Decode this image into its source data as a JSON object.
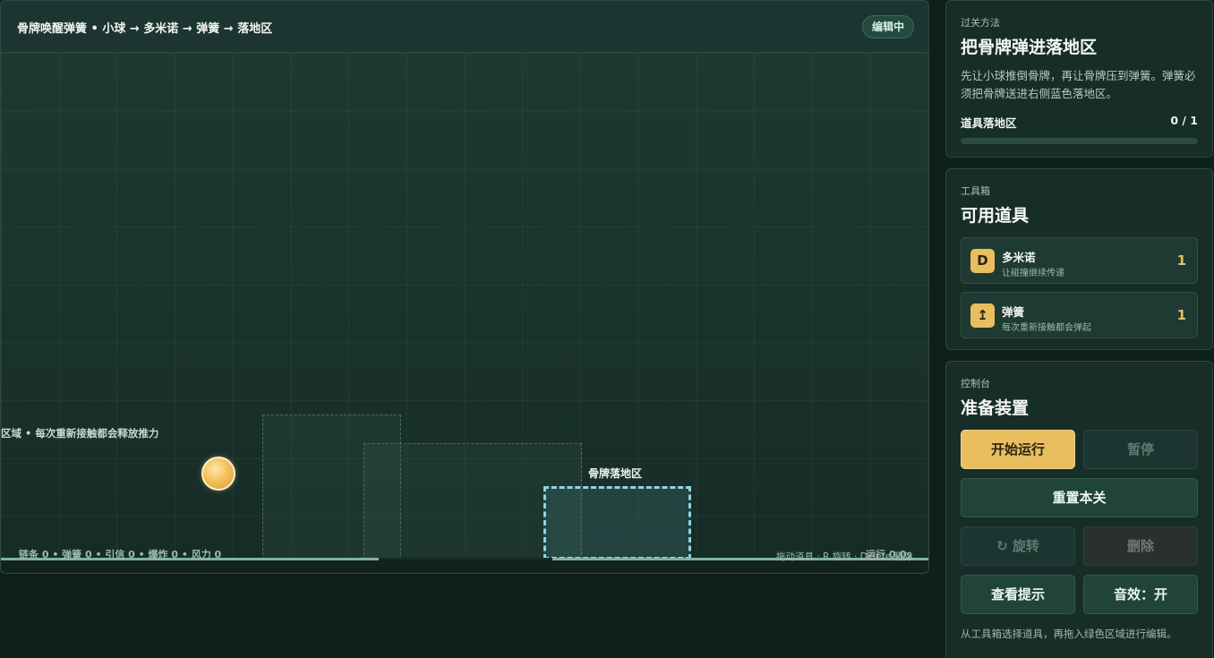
{
  "stage": {
    "title": "骨牌唤醒弹簧 • 小球 → 多米诺 → 弹簧 → 落地区",
    "status_badge": "编辑中",
    "spring_hint": "区域 • 每次重新接触都会释放推力",
    "landing_zone_label": "骨牌落地区",
    "counts_text": "链条 0 • 弹簧 0 • 引信 0 • 爆炸 0 • 风力 0",
    "drag_hint": "拖动道具 · R 旋转 · Delete 删除",
    "run_time": "运行 0.0s"
  },
  "objective": {
    "eyebrow": "过关方法",
    "title": "把骨牌弹进落地区",
    "description": "先让小球推倒骨牌，再让骨牌压到弹簧。弹簧必须把骨牌送进右侧蓝色落地区。",
    "progress_label": "道具落地区",
    "progress_text": "0 / 1",
    "progress_fraction": 0
  },
  "toolbox": {
    "eyebrow": "工具箱",
    "title": "可用道具",
    "items": [
      {
        "icon": "D",
        "icon_name": "domino-icon",
        "name": "多米诺",
        "desc": "让碰撞继续传递",
        "count": "1"
      },
      {
        "icon": "↥",
        "icon_name": "spring-icon",
        "name": "弹簧",
        "desc": "每次重新接触都会弹起",
        "count": "1"
      }
    ]
  },
  "controls": {
    "eyebrow": "控制台",
    "title": "准备装置",
    "start_label": "开始运行",
    "pause_label": "暂停",
    "reset_label": "重置本关",
    "rotate_label": "↻ 旋转",
    "delete_label": "删除",
    "hint_label": "查看提示",
    "sound_label": "音效：开",
    "footer_hint": "从工具箱选择道具，再拖入绿色区域进行编辑。"
  },
  "colors": {
    "accent": "#e9be5f",
    "landing_zone": "#8fd3e6",
    "ground": "#7fb39a"
  }
}
